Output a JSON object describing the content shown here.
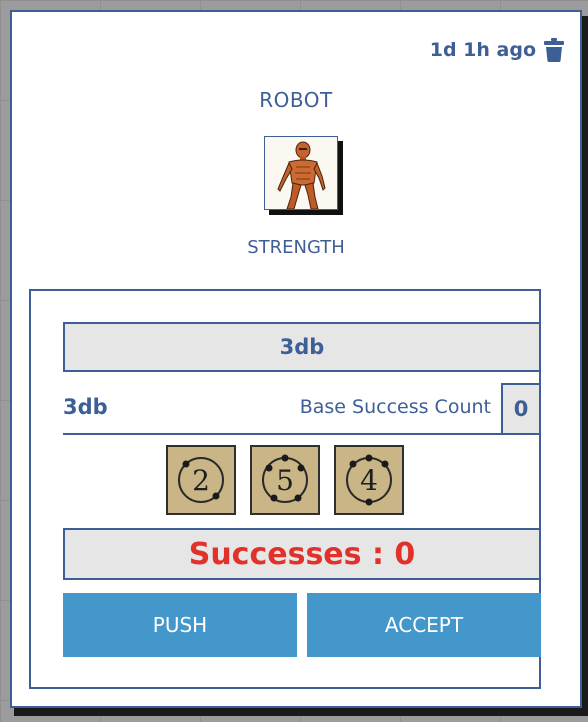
{
  "header": {
    "timestamp": "1d 1h ago",
    "delete_icon": "trash-icon"
  },
  "character": {
    "name": "ROBOT",
    "portrait_icon": "robot-portrait",
    "attribute": "STRENGTH"
  },
  "roll": {
    "dice_pool": "3db",
    "pool_label": "3db",
    "base_success_label": "Base Success Count",
    "base_success_value": "0",
    "dice": [
      {
        "value": "2",
        "name": "die-2"
      },
      {
        "value": "5",
        "name": "die-5"
      },
      {
        "value": "4",
        "name": "die-4"
      }
    ],
    "successes_text": "Successes : 0"
  },
  "buttons": {
    "push_label": "PUSH",
    "accept_label": "ACCEPT"
  },
  "colors": {
    "accent": "#3e5f96",
    "button": "#4397cb",
    "success_text": "#e0322a",
    "die_face": "#c9b586",
    "panel_fill": "#e6e6e6"
  }
}
